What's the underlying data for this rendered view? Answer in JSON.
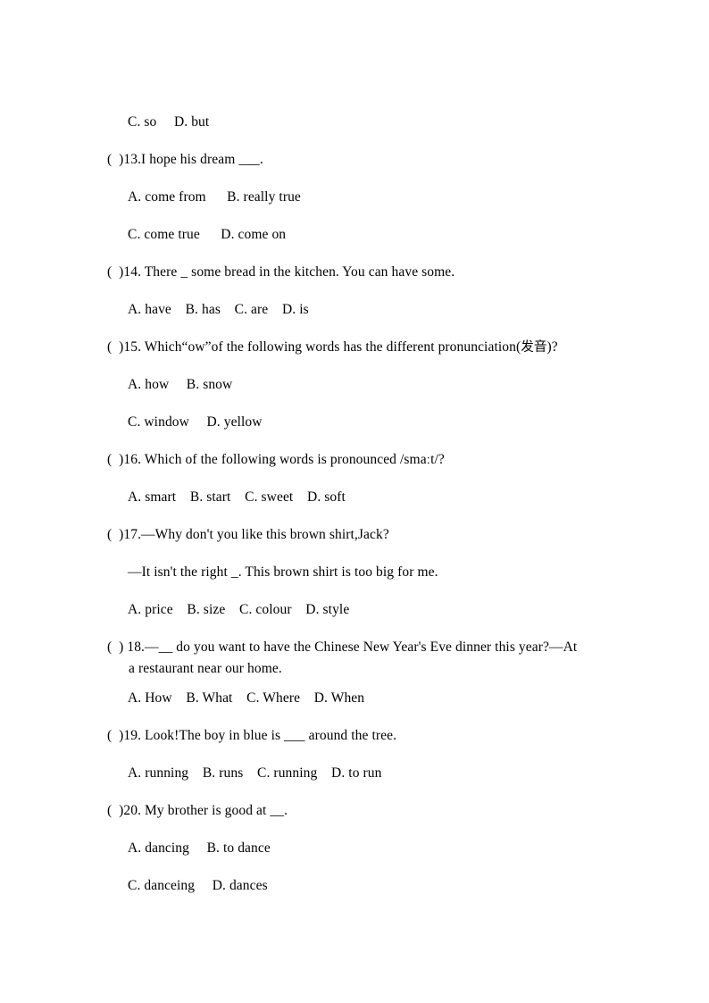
{
  "document": {
    "type": "multiple-choice-worksheet",
    "language": "English exam paper with Chinese gloss",
    "background_color": "#ffffff",
    "text_color": "#000000"
  },
  "lines": [
    {
      "id": "q12-options-cd",
      "kind": "options",
      "text": "C. so  D. but"
    },
    {
      "id": "q13-stem",
      "kind": "question",
      "text": "( )13.I hope his dream ___."
    },
    {
      "id": "q13-options-ab",
      "kind": "options",
      "text": "A. come from  B. really true"
    },
    {
      "id": "q13-options-cd",
      "kind": "options",
      "text": "C. come true  D. come on"
    },
    {
      "id": "q14-stem",
      "kind": "question",
      "text": "( )14. There _ some bread in the kitchen. You can have some."
    },
    {
      "id": "q14-options",
      "kind": "options",
      "text": "A. have  B. has  C. are  D. is"
    },
    {
      "id": "q15-stem",
      "kind": "question",
      "text_before": "( )15. Which“ow”of the following words has the different pronunciation(",
      "gloss_cjk": "发音",
      "text_after": ")?"
    },
    {
      "id": "q15-options-ab",
      "kind": "options",
      "text": "A. how  B. snow"
    },
    {
      "id": "q15-options-cd",
      "kind": "options",
      "text": "C. window  D. yellow"
    },
    {
      "id": "q16-stem",
      "kind": "question",
      "text": "( )16. Which of the following words is pronounced /smaːt/?"
    },
    {
      "id": "q16-options",
      "kind": "options",
      "text": "A. smart  B. start  C. sweet  D. soft"
    },
    {
      "id": "q17-stem",
      "kind": "question",
      "text": "( )17.—Why don't you like this brown shirt,Jack?"
    },
    {
      "id": "q17-stem-b",
      "kind": "question-continued",
      "text": "—It isn't the right _. This brown shirt is too big for me."
    },
    {
      "id": "q17-options",
      "kind": "options",
      "text": "A. price  B. size  C. colour  D. style"
    },
    {
      "id": "q18-stem",
      "kind": "question-wrapping",
      "text": "( ) 18.—__ do you want to have the Chinese New Year's Eve dinner this year?—At",
      "wrap_text": "a restaurant near our home."
    },
    {
      "id": "q18-options",
      "kind": "options",
      "text": "A. How  B. What  C. Where  D. When"
    },
    {
      "id": "q19-stem",
      "kind": "question",
      "text": "( )19. Look!The boy in blue is ___ around the tree."
    },
    {
      "id": "q19-options",
      "kind": "options",
      "text": "A. running  B. runs  C. running  D. to run"
    },
    {
      "id": "q20-stem",
      "kind": "question",
      "text": "( )20. My brother is good at __."
    },
    {
      "id": "q20-options-ab",
      "kind": "options",
      "text": "A. dancing  B. to dance"
    },
    {
      "id": "q20-options-cd",
      "kind": "options",
      "text": "C. danceing  D. dances"
    }
  ]
}
